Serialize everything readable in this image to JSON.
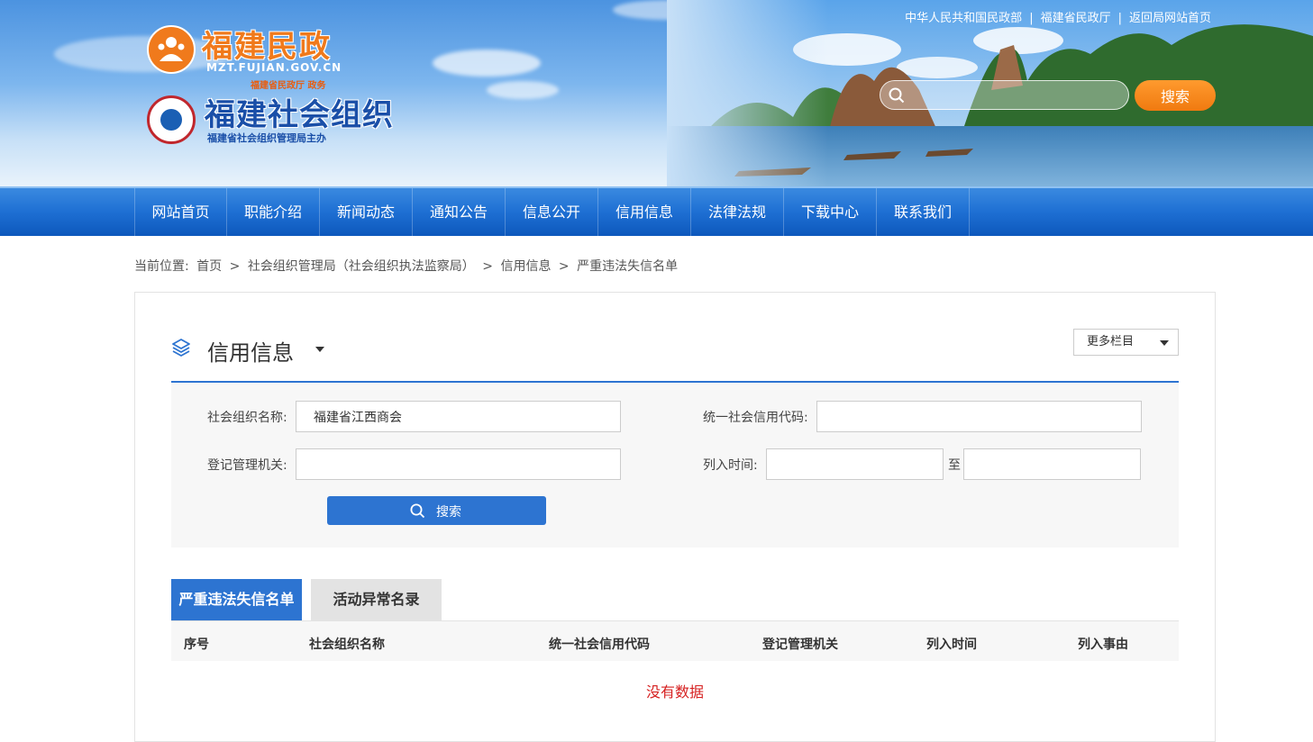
{
  "header": {
    "top_links": [
      "中华人民共和国民政部",
      "福建省民政厅",
      "返回局网站首页"
    ],
    "logo1": {
      "title": "福建民政",
      "url": "MZT.FUJIAN.GOV.CN",
      "sub": "福建省民政厅 政务"
    },
    "logo2": {
      "title": "福建社会组织",
      "sub": "福建省社会组织管理局主办"
    },
    "search": {
      "placeholder": "",
      "button": "搜索"
    }
  },
  "nav": {
    "items": [
      "网站首页",
      "职能介绍",
      "新闻动态",
      "通知公告",
      "信息公开",
      "信用信息",
      "法律法规",
      "下载中心",
      "联系我们"
    ]
  },
  "breadcrumb": [
    "当前位置:",
    "首页",
    ">",
    "社会组织管理局（社会组织执法监察局）",
    ">",
    "信用信息",
    ">",
    "严重违法失信名单"
  ],
  "panel": {
    "title": "信用信息",
    "more_select": "更多栏目",
    "filter": {
      "org_name_label": "社会组织名称:",
      "org_name_value": "福建省江西商会",
      "credit_code_label": "统一社会信用代码:",
      "credit_code_value": "",
      "registry_label": "登记管理机关:",
      "registry_value": "",
      "date_label": "列入时间:",
      "date_from": "",
      "date_sep": "至",
      "date_to": "",
      "search_button": "搜索"
    },
    "tabs": [
      "严重违法失信名单",
      "活动异常名录"
    ],
    "columns": [
      "序号",
      "社会组织名称",
      "统一社会信用代码",
      "登记管理机关",
      "列入时间",
      "列入事由"
    ],
    "empty_text": "没有数据"
  },
  "colors": {
    "accent": "#2d74d1",
    "nav": "#1e6fd3",
    "search_btn": "#f07a10",
    "empty": "#d62020"
  }
}
